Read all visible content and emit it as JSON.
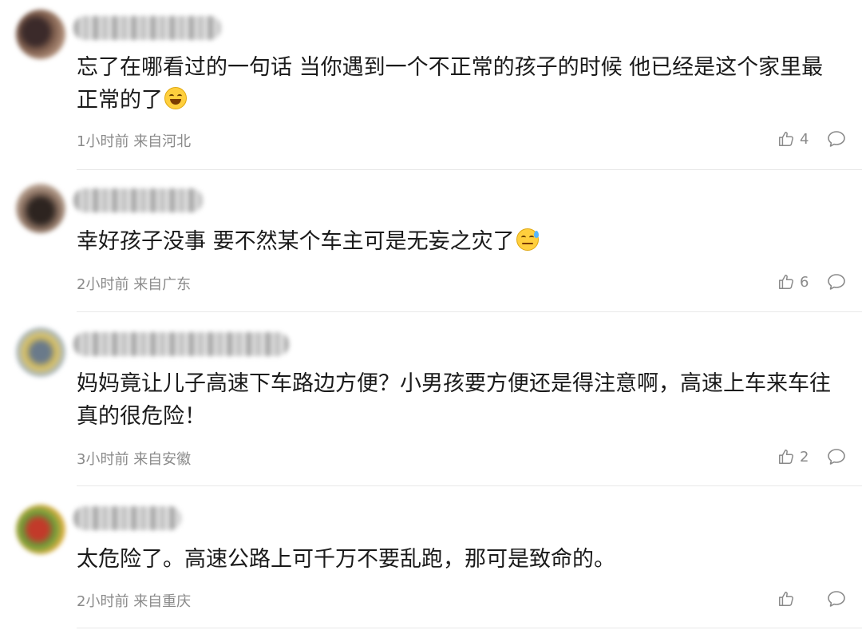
{
  "comments": [
    {
      "text": "忘了在哪看过的一句话 当你遇到一个不正常的孩子的时候 他已经是这个家里最正常的了",
      "emoji_icon": "laughing-tears-emoji-icon",
      "time": "1小时前",
      "location": "来自河北",
      "likes": "4",
      "avatar_colors": [
        "#3b2a2a",
        "#7a5a4a",
        "#b08f7a"
      ]
    },
    {
      "text": "幸好孩子没事 要不然某个车主可是无妄之灾了",
      "emoji_icon": "sweat-emoji-icon",
      "time": "2小时前",
      "location": "来自广东",
      "likes": "6",
      "avatar_colors": [
        "#2d2420",
        "#8a7060",
        "#c9b5a5"
      ]
    },
    {
      "text": "妈妈竟让儿子高速下车路边方便？小男孩要方便还是得注意啊，高速上车来车往真的很危险！",
      "emoji_icon": "",
      "time": "3小时前",
      "location": "来自安徽",
      "likes": "2",
      "avatar_colors": [
        "#6a7a8a",
        "#d9c060",
        "#a8b8c8"
      ]
    },
    {
      "text": "太危险了。高速公路上可千万不要乱跑，那可是致命的。",
      "emoji_icon": "",
      "time": "2小时前",
      "location": "来自重庆",
      "likes": "",
      "avatar_colors": [
        "#c23a2a",
        "#6a9a3a",
        "#e0b040"
      ]
    }
  ]
}
